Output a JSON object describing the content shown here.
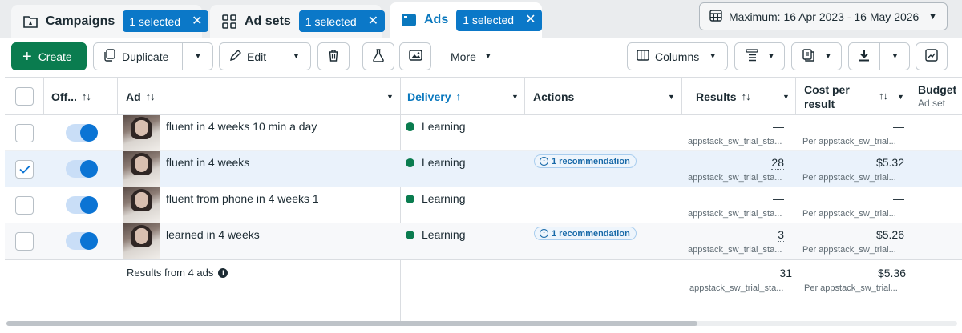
{
  "tabs": [
    {
      "label": "Campaigns",
      "chip": "1 selected",
      "icon": "campaign-folder-icon"
    },
    {
      "label": "Ad sets",
      "chip": "1 selected",
      "icon": "grid-icon"
    },
    {
      "label": "Ads",
      "chip": "1 selected",
      "icon": "ad-window-icon"
    }
  ],
  "date_range": "Maximum: 16 Apr 2023 - 16 May 2026",
  "toolbar": {
    "create": "Create",
    "duplicate": "Duplicate",
    "edit": "Edit",
    "more": "More",
    "columns": "Columns"
  },
  "headers": {
    "off": "Off...",
    "ad": "Ad",
    "delivery": "Delivery",
    "actions": "Actions",
    "results": "Results",
    "cost_line1": "Cost per",
    "cost_line2": "result",
    "budget": "Budget",
    "budget_sub": "Ad set"
  },
  "rows": [
    {
      "name": "fluent in 4 weeks 10 min a day",
      "delivery": "Learning",
      "recommendation": "",
      "results": "—",
      "results_sub": "appstack_sw_trial_sta...",
      "cost": "—",
      "cost_sub": "Per appstack_sw_trial...",
      "selected": false
    },
    {
      "name": "fluent in 4 weeks",
      "delivery": "Learning",
      "recommendation": "1 recommendation",
      "results": "28",
      "results_sub": "appstack_sw_trial_sta...",
      "cost": "$5.32",
      "cost_sub": "Per appstack_sw_trial...",
      "selected": true
    },
    {
      "name": "fluent from phone in 4 weeks 1",
      "delivery": "Learning",
      "recommendation": "",
      "results": "—",
      "results_sub": "appstack_sw_trial_sta...",
      "cost": "—",
      "cost_sub": "Per appstack_sw_trial...",
      "selected": false
    },
    {
      "name": "learned in 4 weeks",
      "delivery": "Learning",
      "recommendation": "1 recommendation",
      "results": "3",
      "results_sub": "appstack_sw_trial_sta...",
      "cost": "$5.26",
      "cost_sub": "Per appstack_sw_trial...",
      "selected": false
    }
  ],
  "footer": {
    "label": "Results from 4 ads",
    "results": "31",
    "results_sub": "appstack_sw_trial_sta...",
    "cost": "$5.36",
    "cost_sub": "Per appstack_sw_trial..."
  },
  "colors": {
    "create_green": "#0a7c4f",
    "chip_blue": "#0b78c8",
    "delivery_dot": "#0a7c4f",
    "toggle_blue": "#0b74d4"
  }
}
